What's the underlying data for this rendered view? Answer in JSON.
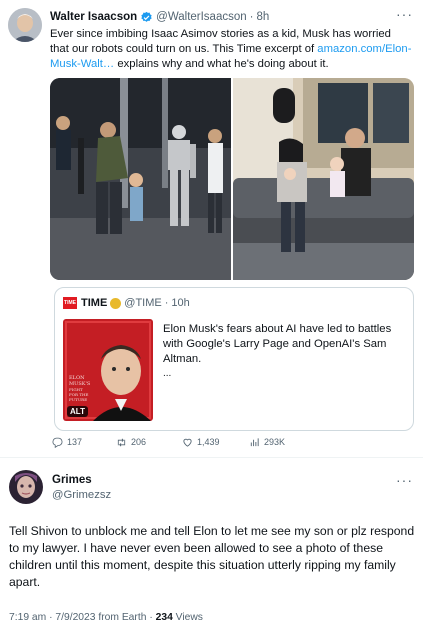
{
  "tweet1": {
    "author_name": "Walter Isaacson",
    "author_handle": "@WalterIsaacson",
    "separator": "·",
    "time": "8h",
    "more": "···",
    "text_before_link": "Ever since imbibing Isaac Asimov stories as a kid, Musk has worried that our robots could turn on us.  This Time excerpt of ",
    "link": "amazon.com/Elon-Musk-Walt…",
    "text_after_link": " explains why and what he's doing about it.",
    "quoted": {
      "logo": "TIME",
      "name": "TIME",
      "handle": "@TIME",
      "separator": "·",
      "time": "10h",
      "text": "Elon Musk's fears about AI have led to battles with Google's Larry Page and OpenAI's Sam Altman.",
      "ellipsis": "...",
      "alt_badge": "ALT",
      "cover_title": "TIME"
    },
    "actions": {
      "replies": "137",
      "retweets": "206",
      "likes": "1,439",
      "views": "293K"
    }
  },
  "tweet2": {
    "author_name": "Grimes",
    "author_handle": "@Grimezsz",
    "more": "···",
    "text": "Tell Shivon to unblock me and tell Elon to let me see my son or plz respond to my lawyer.  I have never even been allowed to see a photo of these children until this moment, despite this situation utterly ripping my family apart.",
    "time": "7:19 am",
    "date": "7/9/2023",
    "source": "from Earth",
    "views_count": "234",
    "views_label": "Views"
  },
  "colors": {
    "link_blue": "#1d9bf0",
    "secondary_text": "#536471",
    "border": "#cfd9de",
    "time_red": "#e11b22"
  },
  "icons": [
    "verified-badge-icon",
    "reply-icon",
    "retweet-icon",
    "like-icon",
    "views-icon",
    "more-icon"
  ]
}
